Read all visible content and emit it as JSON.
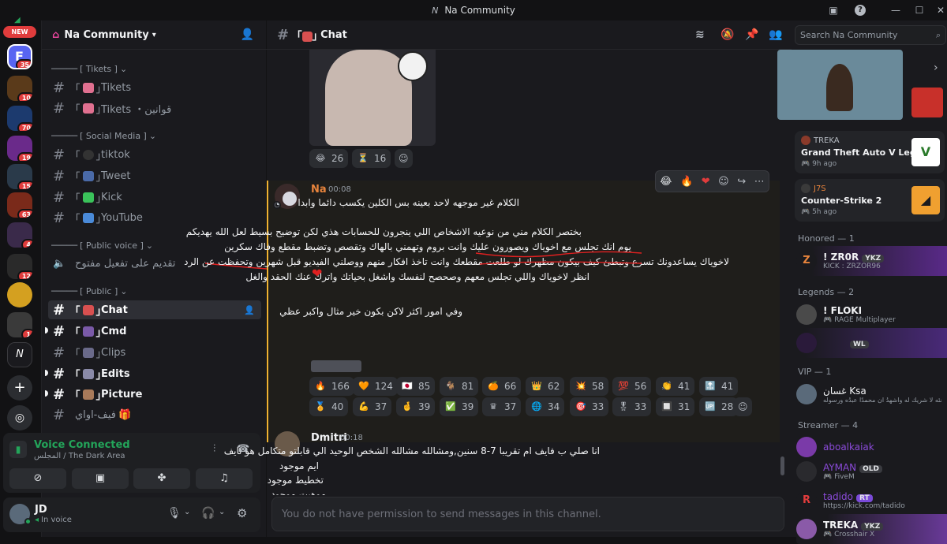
{
  "window": {
    "title": "Na Community"
  },
  "guilds": {
    "new_badge": "NEW",
    "badges": [
      "35",
      "10",
      "70",
      "19",
      "15",
      "63",
      "4",
      "12",
      "1"
    ]
  },
  "sidebar": {
    "server_name": "Na Community",
    "categories": {
      "tikets": "[ Tikets ]",
      "social": "[ Social Media ]",
      "voice": "[ Public voice ]",
      "public": "[ Public ]"
    },
    "channels": {
      "tikets1": "Tikets",
      "tikets2": "Tikets ・قوانين",
      "tiktok": "tiktok",
      "tweet": "Tweet",
      "kick": "Kick",
      "youtube": "YouTube",
      "voice1": "تقديم على تفعيل مفتوح",
      "chat": "Chat",
      "cmd": "Cmd",
      "clips": "Clips",
      "edits": "Edits",
      "picture": "Picture",
      "five": "فيف-اواي"
    }
  },
  "voice": {
    "status": "Voice Connected",
    "channel": "المجلس / The Dark Area"
  },
  "user": {
    "name": "JD",
    "status": "In voice"
  },
  "channel_header": {
    "name": "Chat",
    "search_placeholder": "Search Na Community"
  },
  "messages": {
    "top_reacts": [
      {
        "icon": "😂",
        "count": "26"
      },
      {
        "icon": "⏳",
        "count": "16"
      }
    ],
    "msg1": {
      "author": "Na",
      "time": "00:08",
      "lines": [
        "الكلام غير موجهه لاحد بعينه بس الكلين يكسب دائما وابدا",
        "",
        "بختصر الكلام مني من نوعيه الاشخاص اللي ينجرون للحسابات هذي لكن توضيح بسيط لعل الله يهديكم",
        "يوم انك تجلس مع اخوياك ويصورون عليك وانت بروم وتهمني بالهاك وتقصص وتضبط مقطع وفاك سكرين",
        "لاخوياك يساعدونك تسرع وتبطئ كيف بيكون مظهرك لو طلعت مقطعك وانت تاخذ افكار منهم ووصلني الفيديو قبل شهرين وتحفظت عن الرد",
        "انظر لاخوياك واللي تجلس معهم وصحصح لنفسك واشغل بحياتك واترك عنك الحقد والغل",
        "",
        "",
        "وفي امور اكثر لاكن بكون خير مثال واكبر عظي"
      ],
      "reacts_row1": [
        {
          "icon": "🔥",
          "count": "166"
        },
        {
          "icon": "🧡",
          "count": "124"
        },
        {
          "icon": "🇯🇵",
          "count": "85"
        },
        {
          "icon": "🐐",
          "count": "81"
        },
        {
          "icon": "🍊",
          "count": "66"
        },
        {
          "icon": "👑",
          "count": "62"
        },
        {
          "icon": "💥",
          "count": "58"
        },
        {
          "icon": "💯",
          "count": "56"
        },
        {
          "icon": "👏",
          "count": "41"
        },
        {
          "icon": "🔝",
          "count": "41"
        }
      ],
      "reacts_row2": [
        {
          "icon": "🏅",
          "count": "40"
        },
        {
          "icon": "💪",
          "count": "37"
        },
        {
          "icon": "🤞",
          "count": "39"
        },
        {
          "icon": "✅",
          "count": "39"
        },
        {
          "icon": "♛",
          "count": "37"
        },
        {
          "icon": "🌐",
          "count": "34"
        },
        {
          "icon": "🎯",
          "count": "33"
        },
        {
          "icon": "🎖",
          "count": "33"
        },
        {
          "icon": "🔲",
          "count": "31"
        },
        {
          "icon": "🆙",
          "count": "28"
        }
      ]
    },
    "msg2": {
      "author": "Dmitri",
      "time": "00:18",
      "lines": [
        "انا صلي ب فايف ام تقريبا 7-8 سنين,ومشالله مشالله الشخص الوحيد الي قابلتو متكامل هو نايف",
        "ايم موجود",
        "تخطيط موجود",
        "موهبت موجود"
      ]
    },
    "input_placeholder": "You do not have permission to send messages in this channel."
  },
  "members": {
    "cards": [
      {
        "title": "TREKA",
        "game": "Grand Theft Auto V Legacy",
        "time": "9h ago"
      },
      {
        "title": "J7S",
        "game": "Counter-Strike 2",
        "time": "5h ago"
      }
    ],
    "honored_header": "Honored — 1",
    "honored": [
      {
        "name": "! ZR0R",
        "tag": "YKZ",
        "sub": "KICK : ZRZOR96"
      }
    ],
    "legends_header": "Legends — 2",
    "legends": [
      {
        "name": "! FLOKI",
        "sub": "RAGE Multiplayer"
      },
      {
        "name": "",
        "tag": "WL",
        "sub": ""
      }
    ],
    "vip_header": "VIP — 1",
    "vip": [
      {
        "name": "غسان Ksa",
        "sub": "وجئه لا شريك له واشهدُ ان محمدًا عبدُه ورسوله"
      }
    ],
    "streamer_header": "Streamer — 4",
    "streamers": [
      {
        "name": "aboalkaiak",
        "tag": "",
        "sub": ""
      },
      {
        "name": "AYMAN",
        "tag": "OLD",
        "sub": "FiveM"
      },
      {
        "name": "tadido",
        "tag": "RT",
        "sub": "https://kick.com/tadido"
      },
      {
        "name": "TREKA",
        "tag": "YKZ",
        "sub": "Crosshair X"
      }
    ]
  },
  "colors": {
    "accent": "#5865f2",
    "red": "#f23f43",
    "green": "#23a55a",
    "name_orange": "#e8843c"
  }
}
